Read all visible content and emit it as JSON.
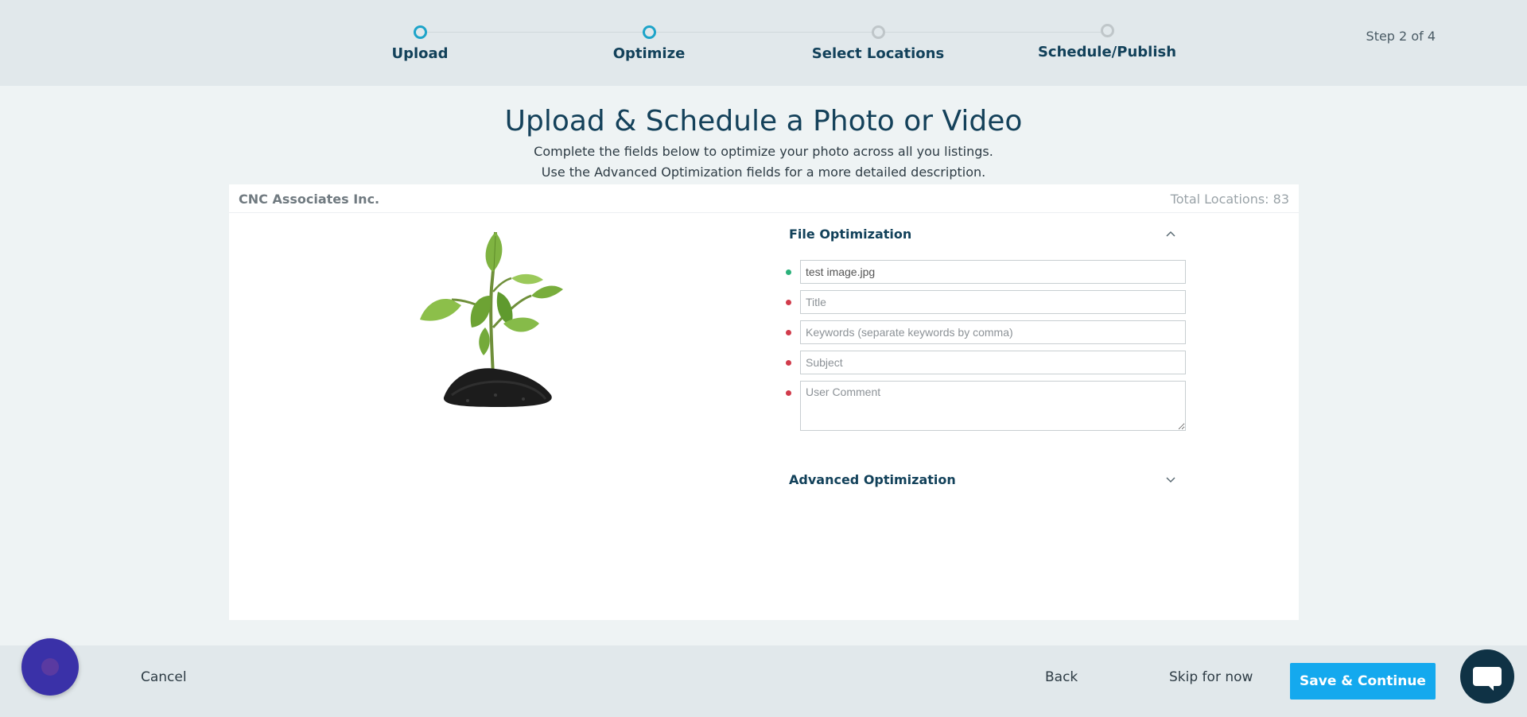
{
  "stepper": {
    "steps": [
      {
        "label": "Upload",
        "state": "done"
      },
      {
        "label": "Optimize",
        "state": "active"
      },
      {
        "label": "Select Locations",
        "state": "pending"
      },
      {
        "label": "Schedule/Publish",
        "state": "pending"
      }
    ],
    "counter": "Step 2 of 4"
  },
  "heading": {
    "title": "Upload & Schedule a Photo or Video",
    "subtitle_1": "Complete the fields below to optimize your photo across all you listings.",
    "subtitle_2": "Use the Advanced Optimization fields for a more detailed description."
  },
  "card": {
    "company": "CNC Associates Inc.",
    "total_locations": "Total Locations: 83",
    "image_alt": "plant seedling in soil"
  },
  "file_optimization": {
    "title": "File Optimization",
    "filename_value": "test image.jpg",
    "title_placeholder": "Title",
    "keywords_placeholder": "Keywords (separate keywords by comma)",
    "subject_placeholder": "Subject",
    "comment_placeholder": "User Comment"
  },
  "advanced_optimization": {
    "title": "Advanced Optimization"
  },
  "footer": {
    "cancel": "Cancel",
    "back": "Back",
    "skip": "Skip for now",
    "save": "Save & Continue"
  },
  "colors": {
    "accent": "#1da4c9",
    "primary_button": "#14a9ee",
    "heading": "#14415a",
    "required_dot": "#d13b4b",
    "valid_dot": "#2bb17a"
  }
}
